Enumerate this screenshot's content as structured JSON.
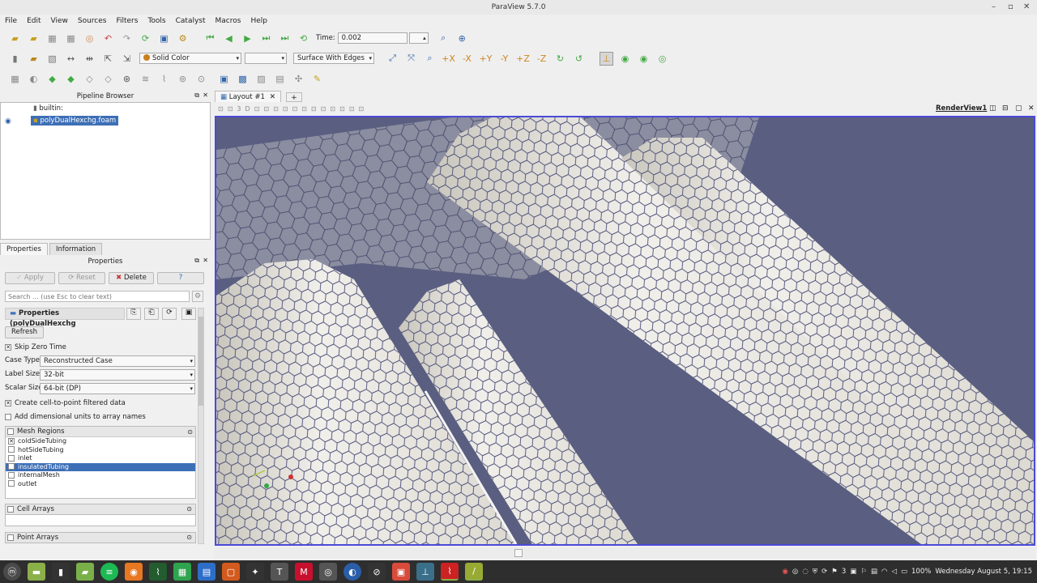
{
  "window": {
    "title": "ParaView 5.7.0"
  },
  "menu": [
    "File",
    "Edit",
    "View",
    "Sources",
    "Filters",
    "Tools",
    "Catalyst",
    "Macros",
    "Help"
  ],
  "toolbar": {
    "time_label": "Time:",
    "time_value": "0.002",
    "coloring": "Solid Color",
    "representation": "Surface With Edges"
  },
  "pipeline": {
    "title": "Pipeline Browser",
    "root": "builtin:",
    "item": "polyDualHexchg.foam"
  },
  "tabs": {
    "properties": "Properties",
    "information": "Information"
  },
  "properties": {
    "title": "Properties",
    "apply": "Apply",
    "reset": "Reset",
    "delete": "Delete",
    "help": "?",
    "search_placeholder": "Search ... (use Esc to clear text)",
    "section": "Properties (polyDualHexchg",
    "refresh": "Refresh",
    "skip_zero_time": "Skip Zero Time",
    "case_type_label": "Case Type",
    "case_type_value": "Reconstructed Case",
    "label_size_label": "Label Size",
    "label_size_value": "32-bit",
    "scalar_size_label": "Scalar Size",
    "scalar_size_value": "64-bit (DP)",
    "create_c2p": "Create cell-to-point filtered data",
    "add_units": "Add dimensional units to array names",
    "mesh_regions_title": "Mesh Regions",
    "mesh_regions": [
      {
        "name": "coldSideTubing",
        "checked": true,
        "selected": false
      },
      {
        "name": "hotSideTubing",
        "checked": false,
        "selected": false
      },
      {
        "name": "inlet",
        "checked": false,
        "selected": false
      },
      {
        "name": "insulatedTubing",
        "checked": false,
        "selected": true
      },
      {
        "name": "internalMesh",
        "checked": false,
        "selected": false
      },
      {
        "name": "outlet",
        "checked": false,
        "selected": false
      }
    ],
    "cell_arrays": "Cell Arrays",
    "point_arrays": "Point Arrays"
  },
  "layout": {
    "tab": "Layout #1",
    "add": "+",
    "view_name": "RenderView1"
  },
  "clock": "Wednesday August 5, 19:15",
  "battery": "100%",
  "workspace_num": "3"
}
